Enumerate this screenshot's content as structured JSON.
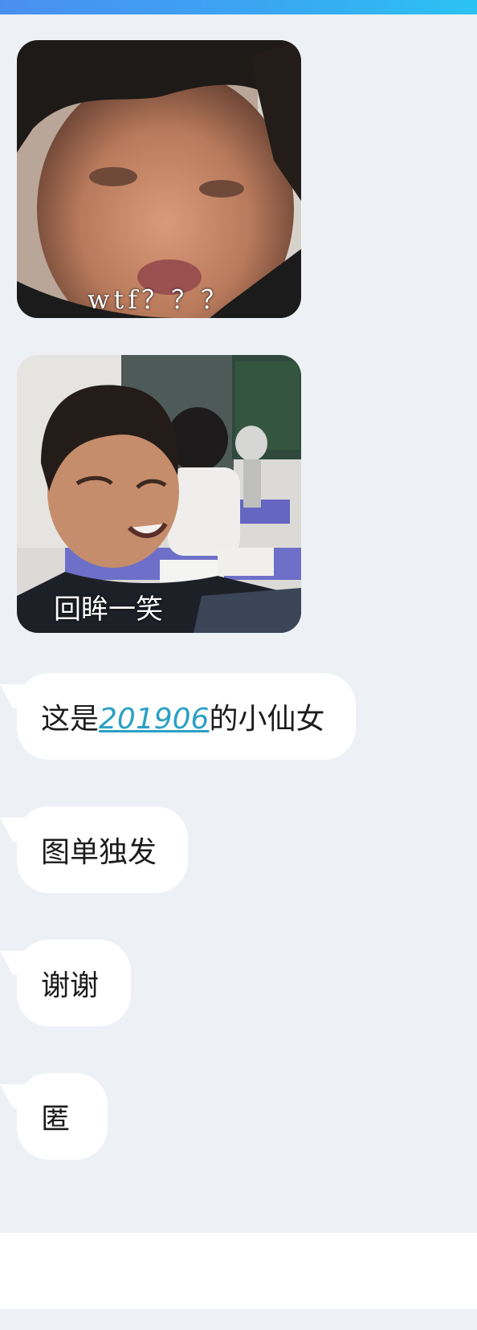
{
  "messages": [
    {
      "type": "image",
      "caption": "wtf？？？",
      "description": "close-up selfie of a boy"
    },
    {
      "type": "image",
      "caption": "回眸一笑",
      "description": "smiling boy in classroom"
    },
    {
      "type": "text",
      "text_before": "这是",
      "link": "201906",
      "text_after": "的小仙女"
    },
    {
      "type": "text",
      "text": "图单独发"
    },
    {
      "type": "text",
      "text": "谢谢"
    },
    {
      "type": "text",
      "text": "匿"
    }
  ],
  "colors": {
    "header_gradient_start": "#4a8ff0",
    "header_gradient_end": "#2bc2f3",
    "chat_background": "#edf1f6",
    "bubble_background": "#ffffff",
    "link": "#2aa0c4"
  }
}
